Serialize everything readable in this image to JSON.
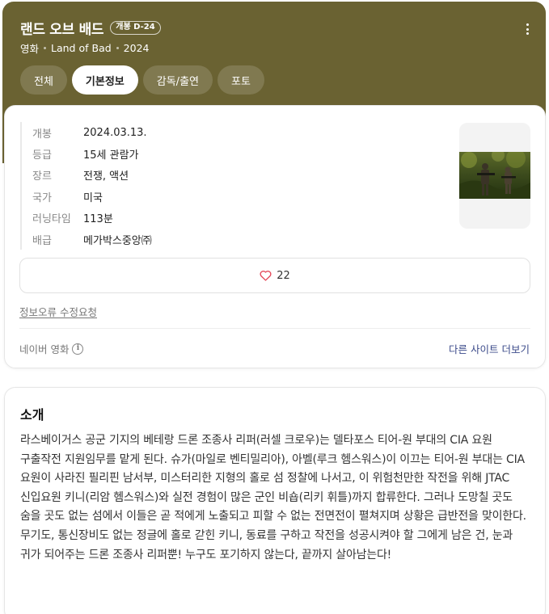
{
  "header": {
    "title": "랜드 오브 배드",
    "dday_badge": "개봉 D-24",
    "subtitle": {
      "type": "영화",
      "original_title": "Land of Bad",
      "year": "2024"
    },
    "tabs": [
      {
        "label": "전체",
        "active": false
      },
      {
        "label": "기본정보",
        "active": true
      },
      {
        "label": "감독/출연",
        "active": false
      },
      {
        "label": "포토",
        "active": false
      }
    ],
    "colors": {
      "background": "#6a6232"
    }
  },
  "info": {
    "rows": [
      {
        "label": "개봉",
        "value": "2024.03.13."
      },
      {
        "label": "등급",
        "value": "15세 관람가"
      },
      {
        "label": "장르",
        "value": "전쟁, 액션"
      },
      {
        "label": "국가",
        "value": "미국"
      },
      {
        "label": "러닝타임",
        "value": "113분"
      },
      {
        "label": "배급",
        "value": "메가박스중앙㈜"
      }
    ],
    "likes": "22",
    "report_link": "정보오류 수정요청",
    "source": "네이버 영화",
    "more_sites": "다른 사이트 더보기"
  },
  "synopsis": {
    "title": "소개",
    "text": "라스베이거스 공군 기지의 베테랑 드론 조종사 리퍼(러셀 크로우)는 델타포스 티어-원 부대의 CIA 요원 구출작전 지원임무를 맡게 된다. 슈가(마일로 벤티밀리아), 아벨(루크 헴스워스)이 이끄는 티어-원 부대는 CIA 요원이 사라진 필리핀 남서부, 미스터리한 지형의 홀로 섬 정찰에 나서고, 이 위험천만한 작전을 위해 JTAC 신입요원 키니(리암 헴스워스)와 실전 경험이 많은 군인 비숍(리키 휘틀)까지 합류한다. 그러나 도망칠 곳도 숨을 곳도 없는 섬에서 이들은 곧 적에게 노출되고 피할 수 없는 전면전이 펼쳐지며 상황은 급반전을 맞이한다. 무기도, 통신장비도 없는 정글에 홀로 갇힌 키니, 동료를 구하고 작전을 성공시켜야 할 그에게 남은 건, 눈과 귀가 되어주는 드론 조종사 리퍼뿐! 누구도 포기하지 않는다, 끝까지 살아남는다!"
  },
  "icons": {
    "more": "more-vertical-icon",
    "heart": "heart-icon",
    "info": "info-icon"
  }
}
